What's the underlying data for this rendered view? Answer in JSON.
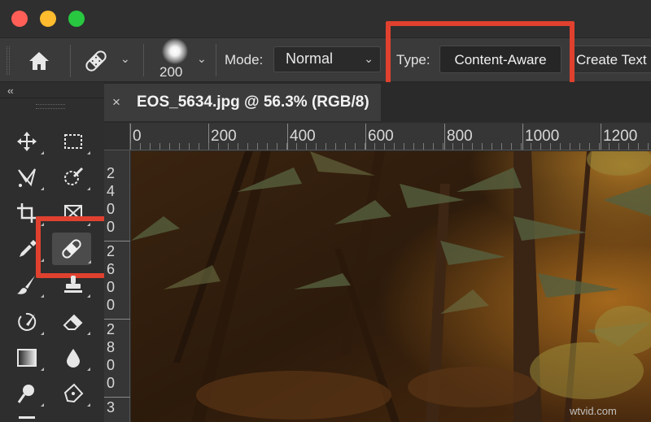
{
  "options_bar": {
    "brush_size": "200",
    "mode_label": "Mode:",
    "mode_value": "Normal",
    "type_label": "Type:",
    "type_value": "Content-Aware",
    "create_texture": "Create Text"
  },
  "toolbar": {
    "collapse": "‹‹",
    "tools": [
      {
        "name": "move-tool",
        "icon": "move-icon"
      },
      {
        "name": "marquee-tool",
        "icon": "rect-marquee-icon"
      },
      {
        "name": "lasso-tool",
        "icon": "polygonal-lasso-icon"
      },
      {
        "name": "quick-select-tool",
        "icon": "quick-selection-icon"
      },
      {
        "name": "crop-tool",
        "icon": "crop-icon"
      },
      {
        "name": "frame-tool",
        "icon": "frame-icon"
      },
      {
        "name": "eyedropper-tool",
        "icon": "eyedropper-icon"
      },
      {
        "name": "spot-healing-tool",
        "icon": "bandage-icon",
        "active": true
      },
      {
        "name": "brush-tool",
        "icon": "brush-icon"
      },
      {
        "name": "stamp-tool",
        "icon": "clone-stamp-icon"
      },
      {
        "name": "history-brush-tool",
        "icon": "history-brush-icon"
      },
      {
        "name": "eraser-tool",
        "icon": "eraser-icon"
      },
      {
        "name": "gradient-tool",
        "icon": "gradient-icon"
      },
      {
        "name": "blur-tool",
        "icon": "drop-icon"
      },
      {
        "name": "dodge-tool",
        "icon": "dodge-icon"
      },
      {
        "name": "pen-tool",
        "icon": "pen-icon"
      }
    ]
  },
  "document": {
    "tab_title": "EOS_5634.jpg @ 56.3% (RGB/8)",
    "close": "×"
  },
  "rulers": {
    "top": [
      "0",
      "200",
      "400",
      "600",
      "800",
      "1000",
      "1200"
    ],
    "left": [
      "2",
      "4",
      "0",
      "0",
      "2",
      "6",
      "0",
      "0",
      "2",
      "8",
      "0",
      "0",
      "3"
    ]
  },
  "watermark": "wtvid.com",
  "colors": {
    "highlight": "#e0412f",
    "panel": "#3a3a3a",
    "window": "#2b2b2b"
  }
}
